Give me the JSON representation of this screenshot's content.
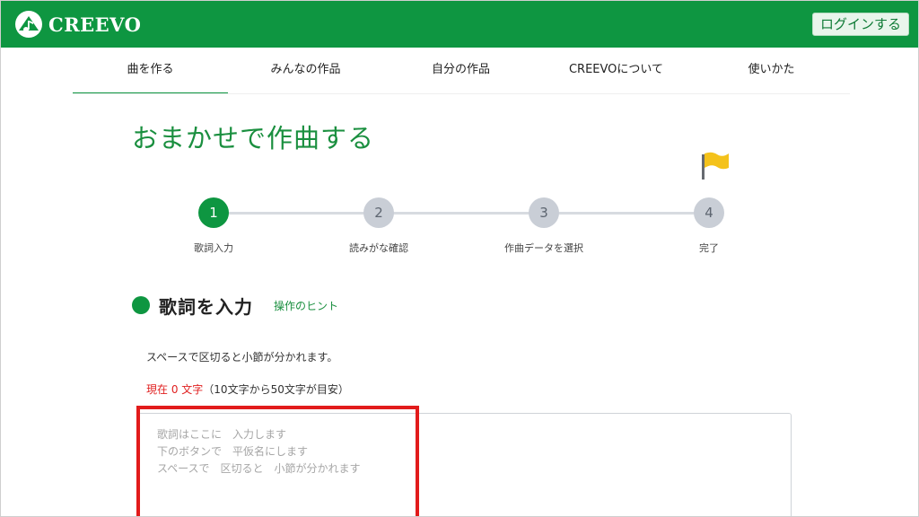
{
  "header": {
    "logo_text": "CREEVO",
    "login_label": "ログインする"
  },
  "nav": {
    "items": [
      {
        "label": "曲を作る",
        "active": true
      },
      {
        "label": "みんなの作品",
        "active": false
      },
      {
        "label": "自分の作品",
        "active": false
      },
      {
        "label": "CREEVOについて",
        "active": false
      },
      {
        "label": "使いかた",
        "active": false
      }
    ]
  },
  "page": {
    "title": "おまかせで作曲する"
  },
  "steps": [
    {
      "number": "1",
      "label": "歌詞入力",
      "active": true
    },
    {
      "number": "2",
      "label": "読みがな確認",
      "active": false
    },
    {
      "number": "3",
      "label": "作曲データを選択",
      "active": false
    },
    {
      "number": "4",
      "label": "完了",
      "active": false
    }
  ],
  "section": {
    "title": "歌詞を入力",
    "hint_link": "操作のヒント",
    "instruction": "スペースで区切ると小節が分かれます。",
    "count_prefix": "現在 ",
    "count_value": "0",
    "count_suffix": " 文字",
    "count_note": "（10文字から50文字が目安）"
  },
  "lyrics": {
    "placeholder_lines": [
      "歌詞はここに　入力します",
      "下のボタンで　平仮名にします",
      "スペースで　区切ると　小節が分かれます"
    ]
  },
  "colors": {
    "brand_green": "#0e9641",
    "highlight_red": "#e21b1b"
  }
}
